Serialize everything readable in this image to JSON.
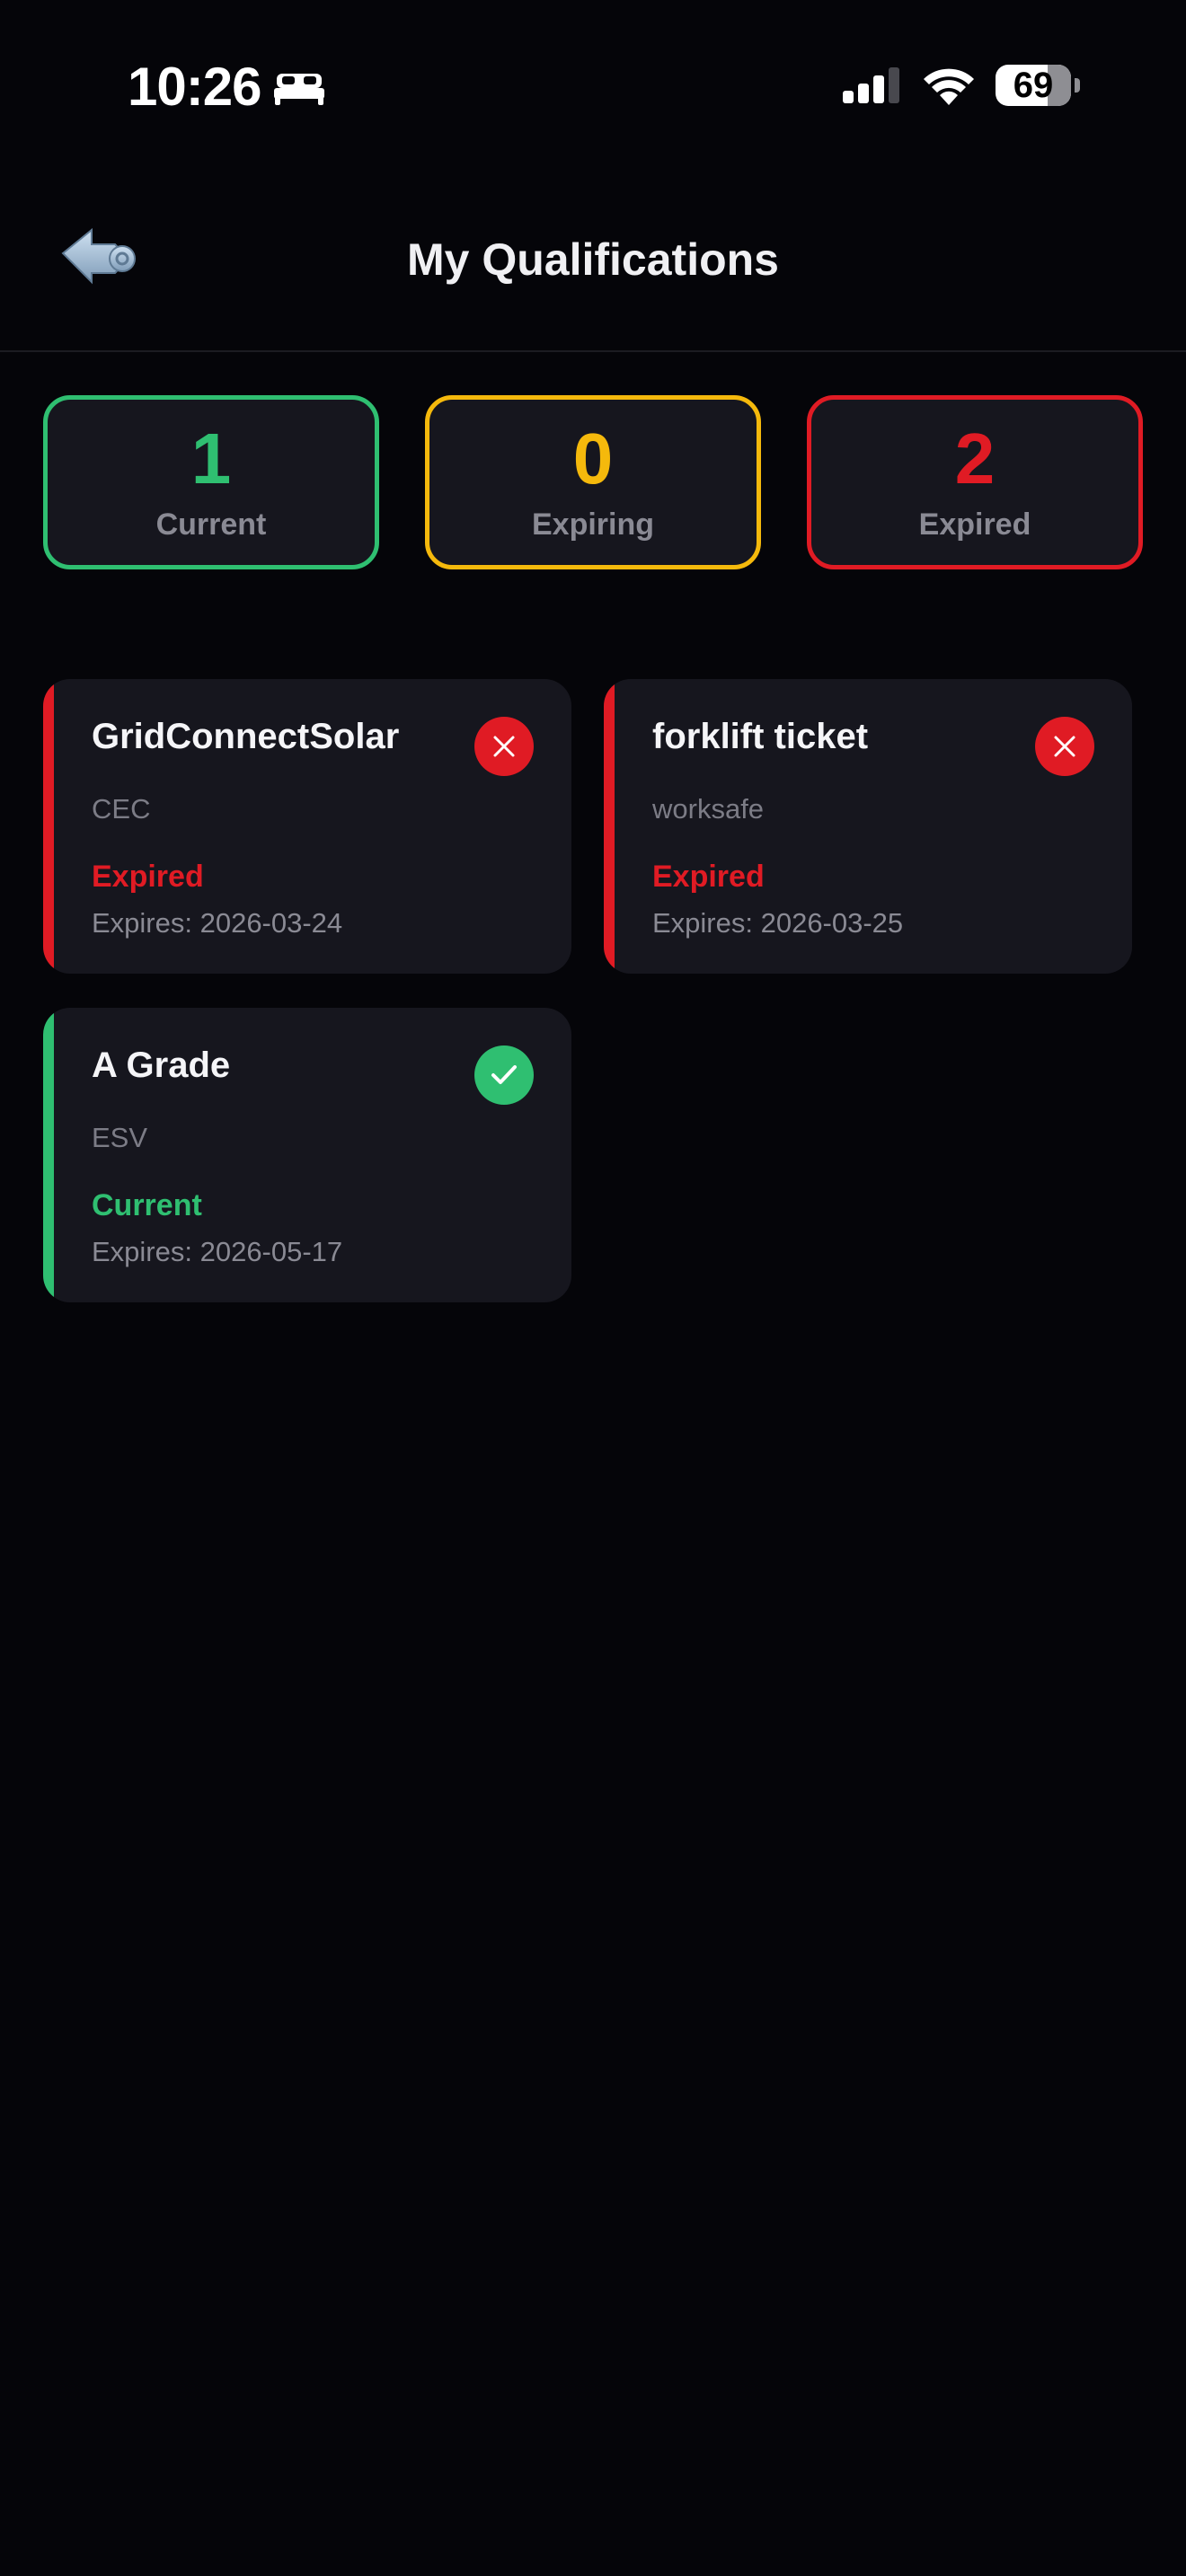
{
  "status_bar": {
    "time": "10:26",
    "battery": "69"
  },
  "header": {
    "title": "My Qualifications",
    "back_icon": "back-arrow-icon"
  },
  "summary": [
    {
      "count": "1",
      "label": "Current",
      "color": "#2fbf71"
    },
    {
      "count": "0",
      "label": "Expiring",
      "color": "#f5b90c"
    },
    {
      "count": "2",
      "label": "Expired",
      "color": "#e01b24"
    }
  ],
  "colors": {
    "current": "#2fbf71",
    "expiring": "#f5b90c",
    "expired": "#e01b24",
    "card_bg": "#16161e",
    "background": "#050509"
  },
  "qualifications": [
    {
      "name": "GridConnectSolar",
      "issuer": "CEC",
      "status": "Expired",
      "expiry": "Expires: 2026-03-24",
      "icon": "close-icon"
    },
    {
      "name": "forklift ticket",
      "issuer": "worksafe",
      "status": "Expired",
      "expiry": "Expires: 2026-03-25",
      "icon": "close-icon"
    },
    {
      "name": "A Grade",
      "issuer": "ESV",
      "status": "Current",
      "expiry": "Expires: 2026-05-17",
      "icon": "check-icon"
    }
  ]
}
